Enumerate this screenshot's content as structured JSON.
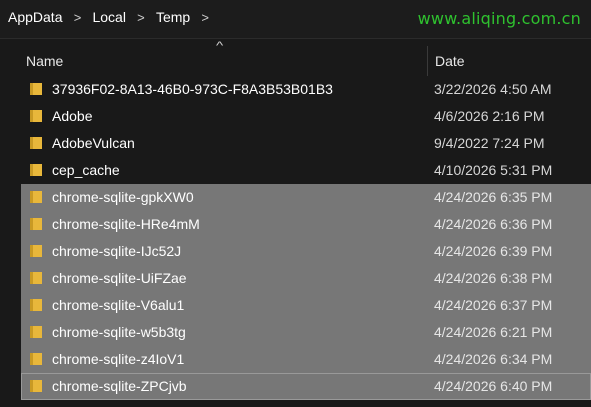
{
  "breadcrumb": {
    "items": [
      "AppData",
      "Local",
      "Temp"
    ],
    "separator": ">"
  },
  "watermark": "www.aliqing.com.cn",
  "columns": {
    "name": "Name",
    "date": "Date",
    "sort_indicator": "chevron-up-icon"
  },
  "colors": {
    "folder": "#e8b73b",
    "selection": "#777777",
    "background": "#191919",
    "watermark": "#2fc22f"
  },
  "rows": [
    {
      "name": "37936F02-8A13-46B0-973C-F8A3B53B01B3",
      "date": "3/22/2026 4:50 AM",
      "selected": false
    },
    {
      "name": "Adobe",
      "date": "4/6/2026 2:16 PM",
      "selected": false
    },
    {
      "name": "AdobeVulcan",
      "date": "9/4/2022 7:24 PM",
      "selected": false
    },
    {
      "name": "cep_cache",
      "date": "4/10/2026 5:31 PM",
      "selected": false
    },
    {
      "name": "chrome-sqlite-gpkXW0",
      "date": "4/24/2026 6:35 PM",
      "selected": true
    },
    {
      "name": "chrome-sqlite-HRe4mM",
      "date": "4/24/2026 6:36 PM",
      "selected": true
    },
    {
      "name": "chrome-sqlite-IJc52J",
      "date": "4/24/2026 6:39 PM",
      "selected": true
    },
    {
      "name": "chrome-sqlite-UiFZae",
      "date": "4/24/2026 6:38 PM",
      "selected": true
    },
    {
      "name": "chrome-sqlite-V6alu1",
      "date": "4/24/2026 6:37 PM",
      "selected": true
    },
    {
      "name": "chrome-sqlite-w5b3tg",
      "date": "4/24/2026 6:21 PM",
      "selected": true
    },
    {
      "name": "chrome-sqlite-z4IoV1",
      "date": "4/24/2026 6:34 PM",
      "selected": true
    },
    {
      "name": "chrome-sqlite-ZPCjvb",
      "date": "4/24/2026 6:40 PM",
      "selected": true,
      "focused": true
    }
  ]
}
